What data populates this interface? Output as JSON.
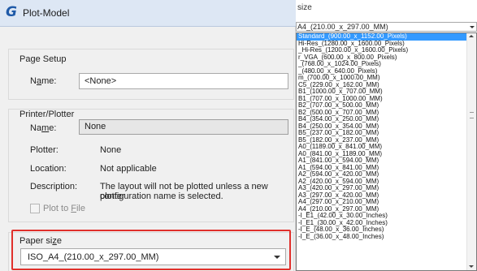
{
  "dialog": {
    "title": "Plot-Model",
    "app_icon": "G"
  },
  "page_setup": {
    "title": "Page Setup",
    "name_label_pre": "N",
    "name_label_under": "a",
    "name_label_post": "me:",
    "name_value": "<None>"
  },
  "printer": {
    "title": "Printer/Plotter",
    "name_label_pre": "Na",
    "name_label_under": "m",
    "name_label_post": "e:",
    "name_value": "None",
    "plotter_label": "Plotter:",
    "plotter_value": "None",
    "location_label": "Location:",
    "location_value": "Not applicable",
    "description_label": "Description:",
    "description_line1": "The layout will not be plotted unless a new plotter",
    "description_line2": "configuration name is selected.",
    "plot_to_file_pre": "Plot to ",
    "plot_to_file_under": "F",
    "plot_to_file_post": "ile"
  },
  "paper": {
    "title_pre": "Paper si",
    "title_under": "z",
    "title_post": "e",
    "value": "ISO_A4_(210.00_x_297.00_MM)",
    "highlight_color": "#e0302b"
  },
  "dropdown": {
    "header": "size",
    "selected_value": "A4_(210.00_x_297.00_MM)",
    "items": [
      "Standard_(900.00_x_1152.00_Pixels)",
      "Hi-Res_(1280.00_x_1600.00_Pixels)",
      "_Hi-Res_(1200.00_x_1600.00_Pixels)",
      "r_VGA_(600.00_x_800.00_Pixels)",
      "_(768.00_x_1024.00_Pixels)",
      "_(480.00_x_640.00_Pixels)",
      "m_(700.00_x_1000.00_MM)",
      "C5_(229.00_x_162.00_MM)",
      "B1_(1000.00_x_707.00_MM)",
      "B1_(707.00_x_1000.00_MM)",
      "B2_(707.00_x_500.00_MM)",
      "B2_(500.00_x_707.00_MM)",
      "B4_(354.00_x_250.00_MM)",
      "B4_(250.00_x_354.00_MM)",
      "B5_(237.00_x_182.00_MM)",
      "B5_(182.00_x_237.00_MM)",
      "A0_(1189.00_x_841.00_MM)",
      "A0_(841.00_x_1189.00_MM)",
      "A1_(841.00_x_594.00_MM)",
      "A1_(594.00_x_841.00_MM)",
      "A2_(594.00_x_420.00_MM)",
      "A2_(420.00_x_594.00_MM)",
      "A3_(420.00_x_297.00_MM)",
      "A3_(297.00_x_420.00_MM)",
      "A4_(297.00_x_210.00_MM)",
      "A4_(210.00_x_297.00_MM)",
      "-I_E1_(42.00_x_30.00_Inches)",
      "-I_E1_(30.00_x_42.00_Inches)",
      "-I_E_(48.00_x_36.00_Inches)",
      "-I_E_(36.00_x_48.00_Inches)"
    ],
    "selected_index": 0,
    "accent": "#3399ff"
  }
}
